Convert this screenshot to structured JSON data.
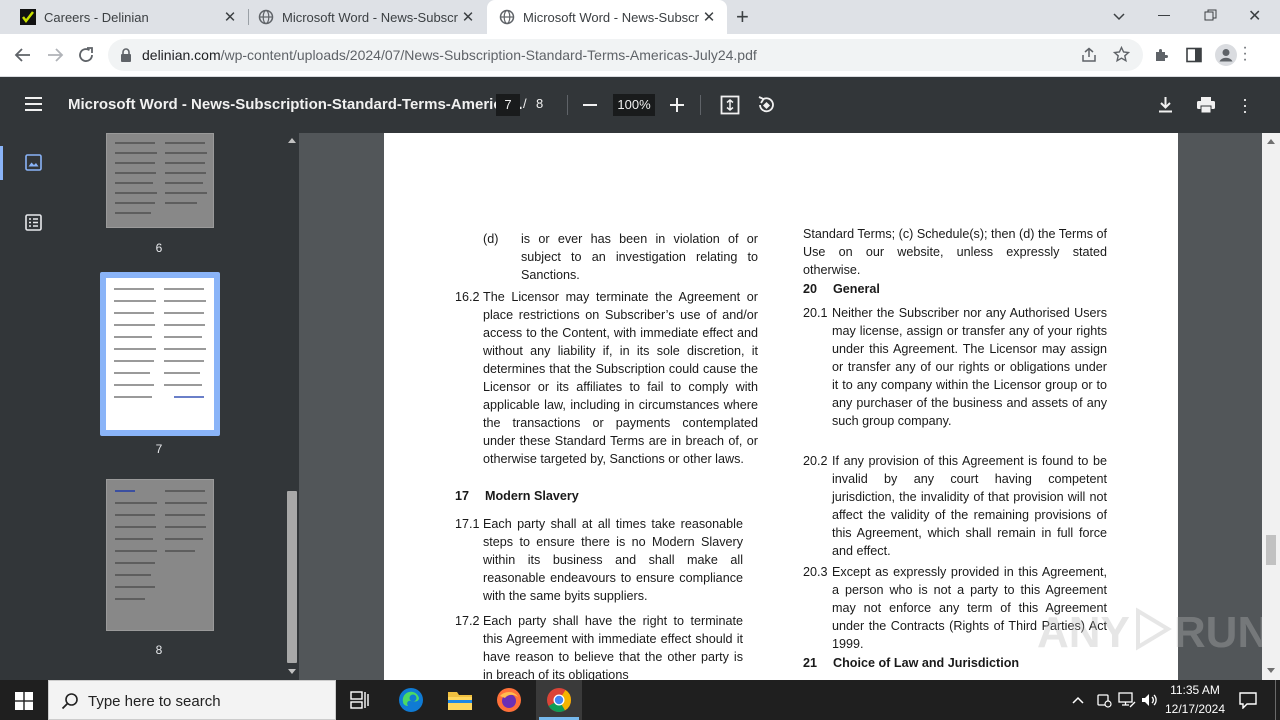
{
  "browser": {
    "tabs": [
      {
        "title": "Careers - Delinian"
      },
      {
        "title": "Microsoft Word - News-Subscription-Standard-Terms"
      },
      {
        "title": "Microsoft Word - News-Subscription-Standard-Terms"
      }
    ],
    "new_tab": "+",
    "url_host": "delinian.com",
    "url_path": "/wp-content/uploads/2024/07/News-Subscription-Standard-Terms-Americas-July24.pdf"
  },
  "pdf_toolbar": {
    "title": "Microsoft Word - News-Subscription-Standard-Terms-America...",
    "current_page": "7",
    "page_separator": "/",
    "total_pages": "8",
    "zoom": "100%"
  },
  "thumbnails": [
    {
      "label": "6"
    },
    {
      "label": "7"
    },
    {
      "label": "8"
    }
  ],
  "document": {
    "left": [
      {
        "num": "(d)",
        "text": "is or ever has been in violation of or subject to an investigation relating to Sanctions."
      },
      {
        "num": "16.2",
        "text": "The Licensor may terminate the Agreement or place restrictions on Subscriber’s use of and/or access to the Content, with immediate effect and without any liability if, in its sole discretion, it determines that the Subscription could cause the Licensor or its affiliates to fail to comply with applicable law, including in circumstances where the transactions or payments contemplated under these Standard Terms are in breach of, or otherwise targeted by, Sanctions or other laws."
      },
      {
        "num": "17",
        "text": "Modern Slavery"
      },
      {
        "num": "17.1",
        "text": "Each party shall at all times take reasonable steps to ensure there is no Modern Slavery within its business and shall make all reasonable endeavours to ensure compliance with the same byits suppliers."
      },
      {
        "num": "17.2",
        "text": "Each party shall have the right to terminate this Agreement with immediate effect should it have reason to believe that the other party is in breach of its obligations"
      }
    ],
    "right": [
      {
        "num": "",
        "text": "Standard Terms; (c) Schedule(s); then (d) the Terms of Use on our website, unless expressly stated otherwise."
      },
      {
        "num": "20",
        "text": "General"
      },
      {
        "num": "20.1",
        "text": "Neither the Subscriber nor any Authorised Users may license, assign or transfer any of your rights under this Agreement. The Licensor may assign or transfer any of our rights or obligations under it to any company within the Licensor group or to any purchaser of the business and assets of any such group company."
      },
      {
        "num": "20.2",
        "text": "If any provision of this Agreement is found to be invalid by any court having competent jurisdiction, the invalidity of that provision will not affect the validity of the remaining provisions of this Agreement, which shall remain in full force and effect."
      },
      {
        "num": "20.3",
        "text": "Except as expressly provided in this Agreement, a person who is not a party to this Agreement may not enforce any term of this Agreement under the Contracts (Rights of Third Parties) Act 1999."
      },
      {
        "num": "21",
        "text": "Choice of Law and Jurisdiction"
      }
    ]
  },
  "watermark": {
    "left": "ANY",
    "right": "RUN"
  },
  "taskbar": {
    "search_placeholder": "Type here to search",
    "time": "11:35 AM",
    "date": "12/17/2024"
  }
}
